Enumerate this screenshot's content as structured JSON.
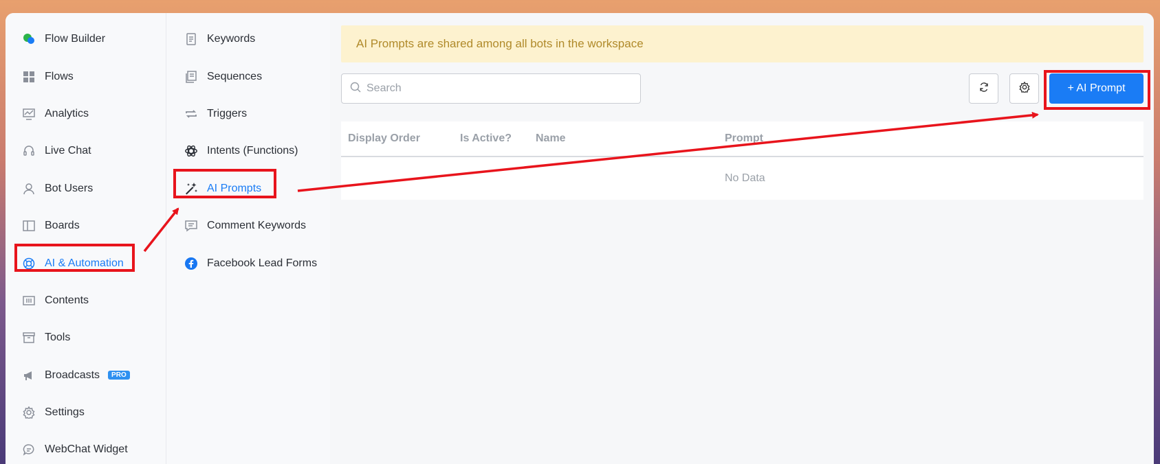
{
  "sidebar": {
    "items": [
      {
        "label": "Flow Builder",
        "icon": "chat-bubbles-icon"
      },
      {
        "label": "Flows",
        "icon": "grid-icon"
      },
      {
        "label": "Analytics",
        "icon": "chart-icon"
      },
      {
        "label": "Live Chat",
        "icon": "headset-icon"
      },
      {
        "label": "Bot Users",
        "icon": "user-icon"
      },
      {
        "label": "Boards",
        "icon": "board-icon"
      },
      {
        "label": "AI & Automation",
        "icon": "lifebuoy-icon",
        "active": true
      },
      {
        "label": "Contents",
        "icon": "contents-icon"
      },
      {
        "label": "Tools",
        "icon": "archive-icon"
      },
      {
        "label": "Broadcasts",
        "icon": "megaphone-icon",
        "badge": "PRO"
      },
      {
        "label": "Settings",
        "icon": "gear-icon"
      },
      {
        "label": "WebChat Widget",
        "icon": "chat-icon"
      }
    ]
  },
  "submenu": {
    "items": [
      {
        "label": "Keywords",
        "icon": "document-icon"
      },
      {
        "label": "Sequences",
        "icon": "stack-icon"
      },
      {
        "label": "Triggers",
        "icon": "repeat-icon"
      },
      {
        "label": "Intents (Functions)",
        "icon": "openai-icon"
      },
      {
        "label": "AI Prompts",
        "icon": "magic-wand-icon",
        "active": true
      },
      {
        "label": "Comment Keywords",
        "icon": "comment-icon"
      },
      {
        "label": "Facebook Lead Forms",
        "icon": "facebook-icon"
      }
    ]
  },
  "main": {
    "banner": "AI Prompts are shared among all bots in the workspace",
    "search_placeholder": "Search",
    "add_button": "+ AI Prompt",
    "table": {
      "columns": [
        "Display Order",
        "Is Active?",
        "Name",
        "Prompt"
      ],
      "empty_text": "No Data"
    }
  },
  "colors": {
    "accent": "#1a7cf5",
    "highlight": "#e8141c",
    "banner_bg": "#fdf2cf",
    "banner_text": "#b08a2a"
  }
}
